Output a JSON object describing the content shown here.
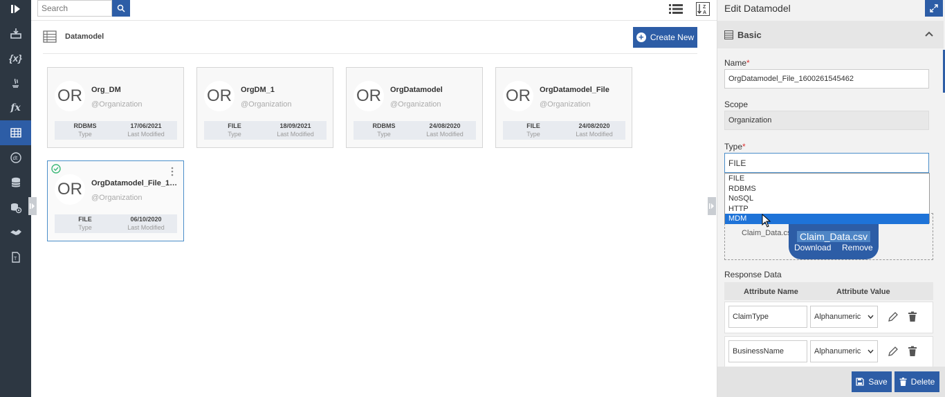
{
  "sidebar": {
    "items": [
      {
        "name": "sidebar-item-import",
        "icon": "import-icon"
      },
      {
        "name": "sidebar-item-variables",
        "icon": "variables-icon",
        "text": "{x}"
      },
      {
        "name": "sidebar-item-java",
        "icon": "java-icon"
      },
      {
        "name": "sidebar-item-functions",
        "icon": "function-icon",
        "text": "fx"
      },
      {
        "name": "sidebar-item-datamodel",
        "icon": "table-icon",
        "active": true
      },
      {
        "name": "sidebar-item-dt",
        "icon": "dt-icon"
      },
      {
        "name": "sidebar-item-database",
        "icon": "database-icon"
      },
      {
        "name": "sidebar-item-settings",
        "icon": "settings-db-icon"
      },
      {
        "name": "sidebar-item-handshake",
        "icon": "handshake-icon"
      },
      {
        "name": "sidebar-item-template",
        "icon": "template-icon"
      }
    ]
  },
  "topbar": {
    "search_placeholder": "Search"
  },
  "header": {
    "title": "Datamodel",
    "create_label": "Create New"
  },
  "cards": [
    {
      "initials": "OR",
      "name": "Org_DM",
      "org": "@Organization",
      "type": "RDBMS",
      "type_label": "Type",
      "date": "17/06/2021",
      "date_label": "Last Modified"
    },
    {
      "initials": "OR",
      "name": "OrgDM_1",
      "org": "@Organization",
      "type": "FILE",
      "type_label": "Type",
      "date": "18/09/2021",
      "date_label": "Last Modified"
    },
    {
      "initials": "OR",
      "name": "OrgDatamodel",
      "org": "@Organization",
      "type": "RDBMS",
      "type_label": "Type",
      "date": "24/08/2020",
      "date_label": "Last Modified"
    },
    {
      "initials": "OR",
      "name": "OrgDatamodel_File",
      "org": "@Organization",
      "type": "FILE",
      "type_label": "Type",
      "date": "24/08/2020",
      "date_label": "Last Modified"
    },
    {
      "initials": "OR",
      "name": "OrgDatamodel_File_1600261545462",
      "org": "@Organization",
      "type": "FILE",
      "type_label": "Type",
      "date": "06/10/2020",
      "date_label": "Last Modified",
      "selected": true
    }
  ],
  "panel": {
    "title": "Edit Datamodel",
    "section": "Basic",
    "name_label": "Name",
    "name_value": "OrgDatamodel_File_1600261545462",
    "scope_label": "Scope",
    "scope_value": "Organization",
    "type_label": "Type",
    "type_value": "FILE",
    "required_mark": "*",
    "type_options": [
      "FILE",
      "RDBMS",
      "NoSQL",
      "HTTP",
      "MDM"
    ],
    "highlighted_option": "MDM",
    "upload_name": "Claim_Data.cs",
    "file_chip_title": "Claim_Data.csv",
    "download_label": "Download",
    "remove_label": "Remove",
    "response_label": "Response Data",
    "attr_name_header": "Attribute Name",
    "attr_value_header": "Attribute Value",
    "rows": [
      {
        "name": "ClaimType",
        "type": "Alphanumeric"
      },
      {
        "name": "BusinessName",
        "type": "Alphanumeric"
      }
    ],
    "save_label": "Save",
    "delete_label": "Delete"
  },
  "colors": {
    "primary": "#2d5da6",
    "sidebar": "#2d3742",
    "highlight": "#1e73d8",
    "success": "#3cb878"
  }
}
